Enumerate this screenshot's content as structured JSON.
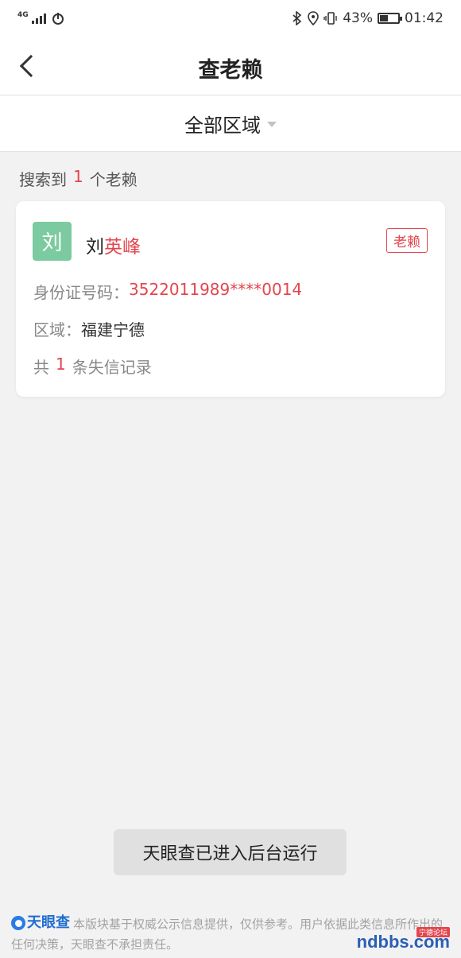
{
  "status_bar": {
    "network": "4G",
    "battery": "43%",
    "time": "01:42"
  },
  "nav": {
    "title": "查老赖"
  },
  "filter": {
    "region_label": "全部区域"
  },
  "search": {
    "prefix": "搜索到",
    "count": "1",
    "suffix": "个老赖"
  },
  "card": {
    "avatar_char": "刘",
    "name_surname": "刘",
    "name_given": "英峰",
    "badge": "老赖",
    "id_label": "身份证号码：",
    "id_value": "3522011989****0014",
    "region_label": "区域：",
    "region_value": "福建宁德",
    "records_prefix": "共",
    "records_count": "1",
    "records_suffix": "条失信记录"
  },
  "toast": {
    "message": "天眼查已进入后台运行"
  },
  "footer": {
    "brand": "天眼查",
    "disclaimer": "本版块基于权威公示信息提供，仅供参考。用户依据此类信息所作出的任何决策，天眼查不承担责任。"
  },
  "watermark": {
    "tag": "宁德论坛",
    "text": "ndbbs.com"
  }
}
